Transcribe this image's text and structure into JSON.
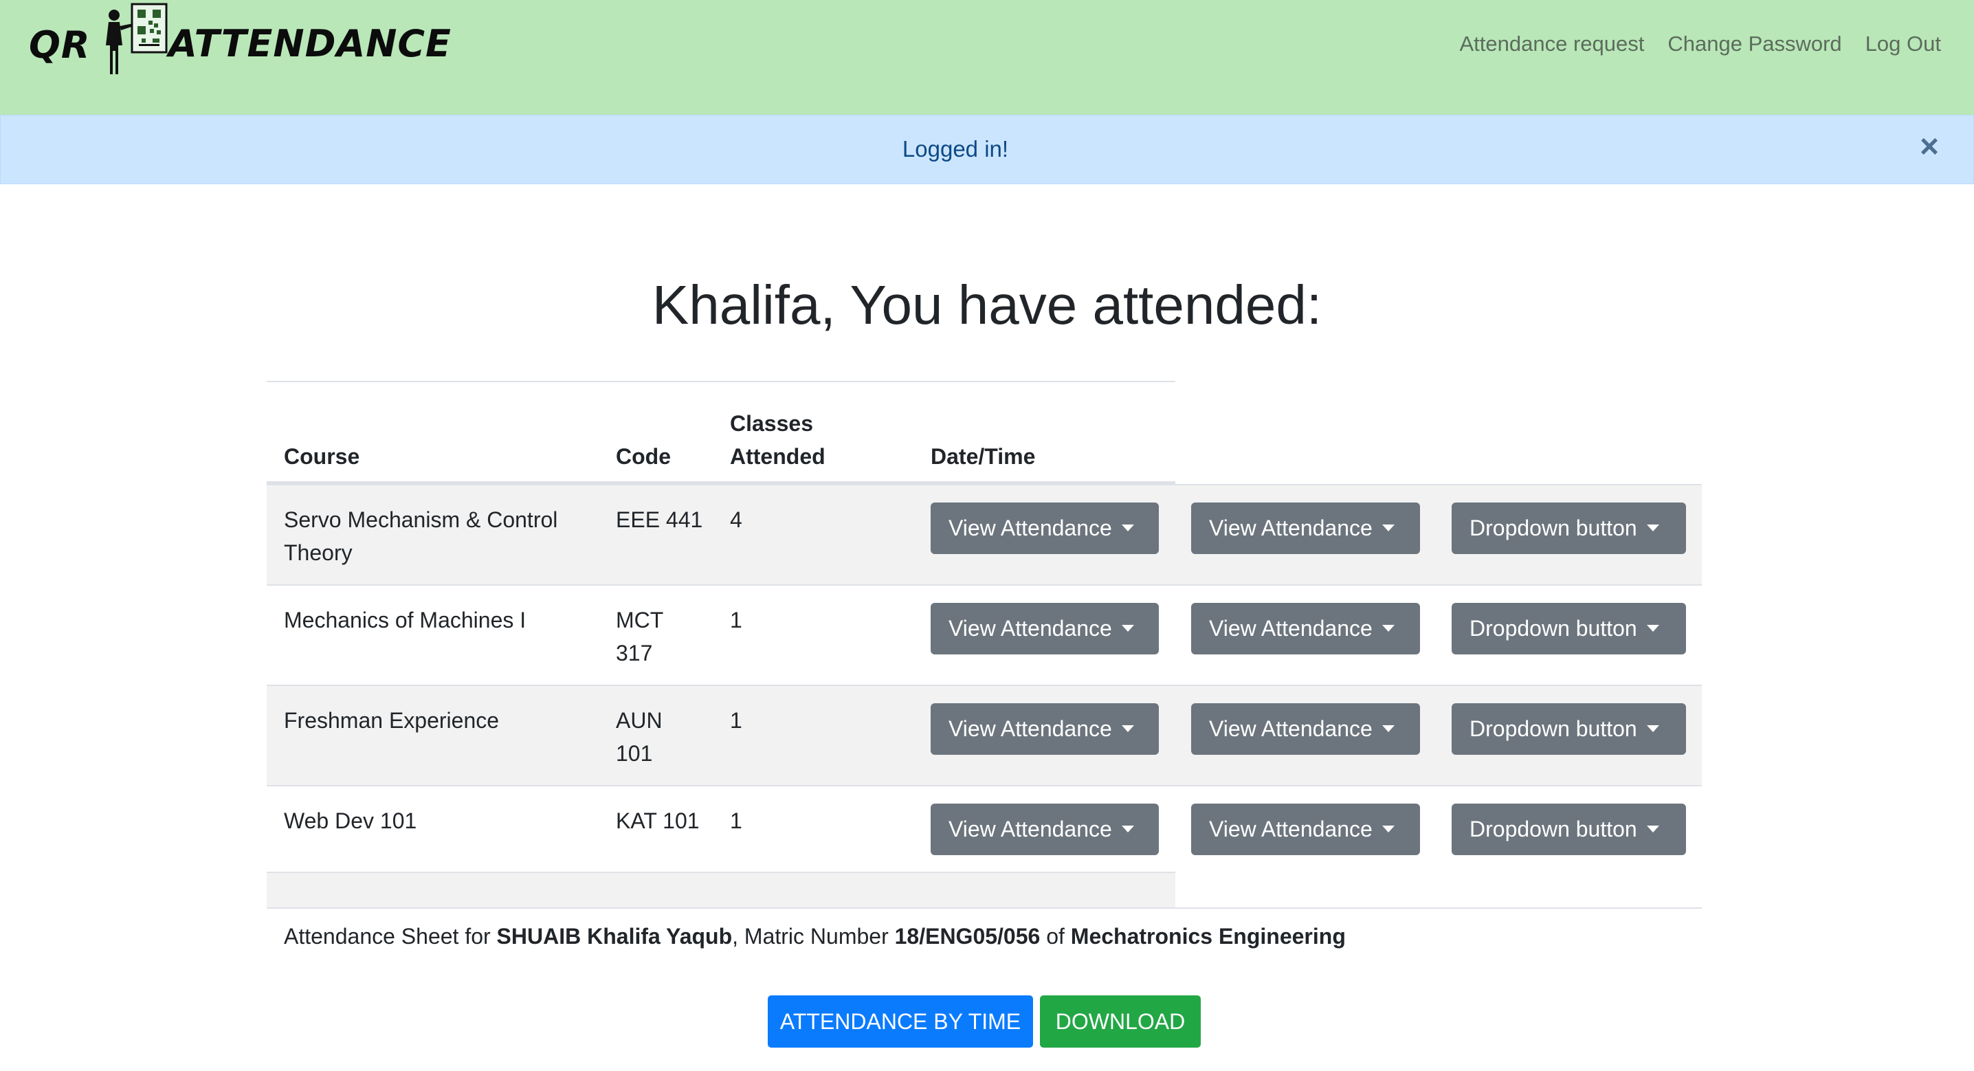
{
  "navbar": {
    "brand_left": "QR",
    "brand_right": "ATTENDANCE",
    "links": [
      "Attendance request",
      "Change Password",
      "Log Out"
    ],
    "background": "#b9e7b8"
  },
  "alert": {
    "message": "Logged in!",
    "close_symbol": "×",
    "background": "#cce5fe"
  },
  "main": {
    "heading": "Khalifa, You have attended:"
  },
  "table": {
    "headers": {
      "course": "Course",
      "code": "Code",
      "classes_attended_line1": "Classes",
      "classes_attended_line2": "Attended",
      "datetime": "Date/Time"
    },
    "rows": [
      {
        "course": "Servo Mechanism & Control Theory",
        "code": "EEE 441",
        "count": "4",
        "btn1": "View Attendance",
        "btn2": "View Attendance",
        "btn3": "Dropdown button"
      },
      {
        "course": "Mechanics of Machines I",
        "code": "MCT 317",
        "count": "1",
        "btn1": "View Attendance",
        "btn2": "View Attendance",
        "btn3": "Dropdown button"
      },
      {
        "course": "Freshman Experience",
        "code": "AUN 101",
        "count": "1",
        "btn1": "View Attendance",
        "btn2": "View Attendance",
        "btn3": "Dropdown button"
      },
      {
        "course": "Web Dev 101",
        "code": "KAT 101",
        "count": "1",
        "btn1": "View Attendance",
        "btn2": "View Attendance",
        "btn3": "Dropdown button"
      }
    ]
  },
  "sheet": {
    "prefix": "Attendance Sheet for ",
    "student_name": "SHUAIB Khalifa Yaqub",
    "matric_label": ", Matric Number ",
    "matric_number": "18/ENG05/056",
    "of_label": " of ",
    "department": "Mechatronics Engineering"
  },
  "actions": {
    "attendance_by_time": "ATTENDANCE BY TIME",
    "download": "DOWNLOAD",
    "blue": "#0b7bfe",
    "green": "#22a745"
  }
}
